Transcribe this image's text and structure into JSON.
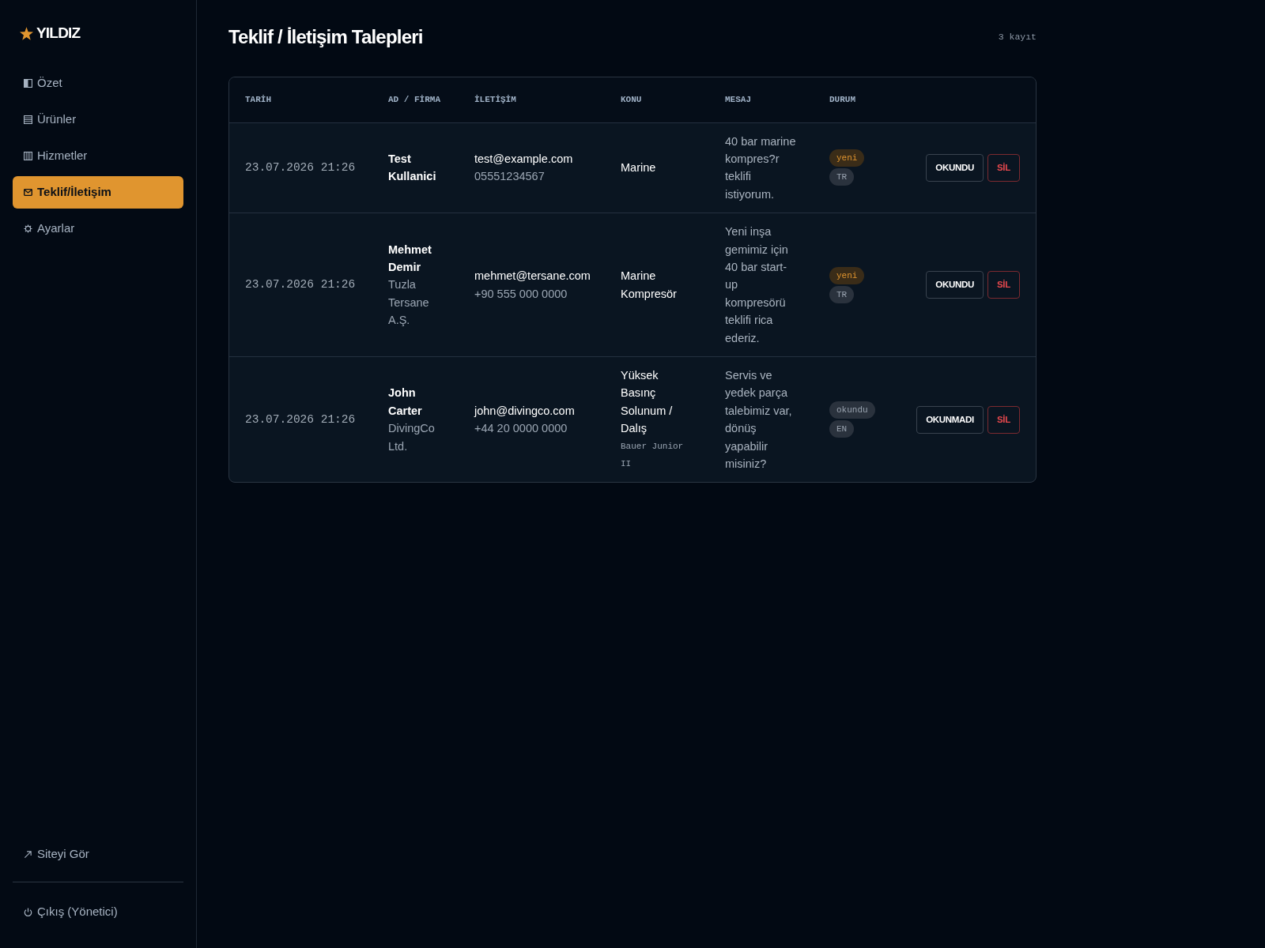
{
  "sidebar": {
    "logo": "YILDIZ",
    "items": [
      {
        "label": "Özet",
        "selected": false
      },
      {
        "label": "Ürünler",
        "selected": false
      },
      {
        "label": "Hizmetler",
        "selected": false
      },
      {
        "label": "Teklif/İletişim",
        "selected": true
      },
      {
        "label": "Ayarlar",
        "selected": false
      }
    ],
    "footer_items": [
      "Siteyi Gör",
      "Çıkış (Yönetici)"
    ]
  },
  "page": {
    "title": "Teklif / İletişim Talepleri",
    "count": "3 kayıt"
  },
  "table": {
    "columns": [
      "TARİH",
      "AD / FİRMA",
      "İLETİŞİM",
      "KONU",
      "MESAJ",
      "DURUM"
    ],
    "rows": [
      {
        "date": "23.07.2026 21:26",
        "name": "Test Kullanici",
        "email": "test@example.com",
        "phone": "05551234567",
        "subject": "Marine",
        "message": "40 bar marine kompres?r teklifi istiyorum.",
        "status": "yeni",
        "read": false,
        "language": "TR",
        "actions": [
          {
            "label": "OKUNDU",
            "kind": "toggle"
          },
          {
            "label": "SİL",
            "kind": "delete"
          }
        ]
      },
      {
        "date": "23.07.2026 21:26",
        "name": "Mehmet Demir",
        "company": "Tuzla Tersane A.Ş.",
        "email": "mehmet@tersane.com",
        "phone": "+90 555 000 0000",
        "subject": "Marine Kompresör",
        "message": "Yeni inşa gemimiz için 40 bar start-up kompresörü teklifi rica ederiz.",
        "status": "yeni",
        "read": false,
        "language": "TR",
        "actions": [
          {
            "label": "OKUNDU",
            "kind": "toggle"
          },
          {
            "label": "SİL",
            "kind": "delete"
          }
        ]
      },
      {
        "date": "23.07.2026 21:26",
        "name": "John Carter",
        "company": "DivingCo Ltd.",
        "email": "john@divingco.com",
        "phone": "+44 20 0000 0000",
        "subject": "Yüksek Basınç Solunum / Dalış",
        "product": "Bauer Junior II",
        "message": "Servis ve yedek parça talebimiz var, dönüş yapabilir misiniz?",
        "status": "okundu",
        "read": true,
        "language": "EN",
        "actions": [
          {
            "label": "OKUNMADI",
            "kind": "toggle"
          },
          {
            "label": "SİL",
            "kind": "delete"
          }
        ]
      }
    ]
  }
}
